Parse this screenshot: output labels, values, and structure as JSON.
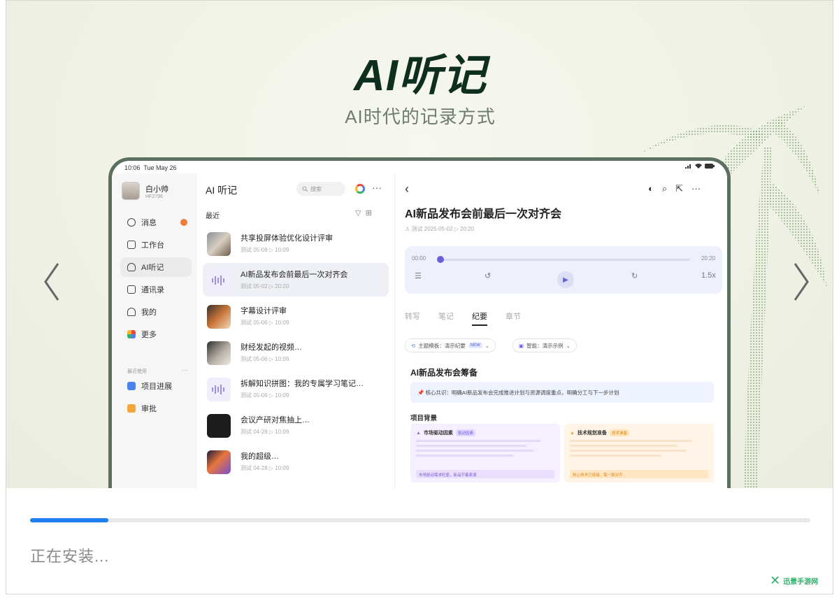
{
  "hero": {
    "title": "AI听记",
    "subtitle": "AI时代的记录方式"
  },
  "tablet": {
    "status": {
      "time": "10:06",
      "date": "Tue May 26"
    },
    "sidebar": {
      "user": {
        "name": "白小帅",
        "sub": "HF2796"
      },
      "items": [
        {
          "label": "消息",
          "icon": "message-icon",
          "badge": true
        },
        {
          "label": "工作台",
          "icon": "grid-icon"
        },
        {
          "label": "AI听记",
          "icon": "record-icon",
          "active": true
        },
        {
          "label": "通讯录",
          "icon": "contacts-icon"
        },
        {
          "label": "我的",
          "icon": "person-icon"
        },
        {
          "label": "更多",
          "icon": "apps-icon"
        }
      ],
      "recent_label": "最近使用",
      "recent_items": [
        {
          "label": "项目进展",
          "icon": "doc-icon",
          "color": "#4b82f0"
        },
        {
          "label": "审批",
          "icon": "approve-icon",
          "color": "#f3a43a"
        }
      ]
    },
    "list": {
      "title": "AI 听记",
      "search_placeholder": "搜索",
      "section": "最近",
      "items": [
        {
          "title": "共享投屏体验优化设计评审",
          "meta": "测试 05-08  ▷ 10:09",
          "thumb": "photo"
        },
        {
          "title": "AI新品发布会前最后一次对齐会",
          "meta": "测试 05-02  ▷ 20:20",
          "thumb": "wave",
          "active": true
        },
        {
          "title": "字幕设计评审",
          "meta": "测试 05-06  ▷ 10:09",
          "thumb": "photo2"
        },
        {
          "title": "财经发起的视频…",
          "meta": "测试 05-06  ▷ 10:09",
          "thumb": "photo3"
        },
        {
          "title": "拆解知识拼图：我的专属学习笔记…",
          "meta": "测试 05-06  ▷ 10:09",
          "thumb": "wave"
        },
        {
          "title": "会议产研对焦抽上…",
          "meta": "测试 04-28  ▷ 10:09",
          "thumb": "dark"
        },
        {
          "title": "我的超级…",
          "meta": "测试 04-28  ▷ 10:09",
          "thumb": "colorful"
        }
      ]
    },
    "detail": {
      "title": "AI新品发布会前最后一次对齐会",
      "meta": "♙ 测试 2025-05-02  ▷ 20:20",
      "player": {
        "start": "00:00",
        "end": "20:20",
        "speed": "1.5x",
        "progress": 0.0
      },
      "tabs": [
        "转写",
        "笔记",
        "纪要",
        "章节"
      ],
      "active_tab": "纪要",
      "chips": [
        {
          "label": "主题模板：演示纪要",
          "tag": "NEW"
        },
        {
          "label": "智能：演示示例"
        }
      ],
      "section_title": "AI新品发布会筹备",
      "notice": "核心共识：明确AI新品发布会完成推进计划与资源调度重点，明确分工与下一步计划",
      "subsection": "项目背景",
      "cards": [
        {
          "title": "市场驱动因素",
          "tag": "驱动因素",
          "foot": "市场驱动需求旺盛，新品节奏紧凑"
        },
        {
          "title": "技术规划准备",
          "tag": "技术准备",
          "foot": "核心技术已就绪，需一致对齐"
        }
      ]
    }
  },
  "install": {
    "status_text": "正在安装...",
    "progress": 0.1
  },
  "watermark": {
    "text": "迅景手游网"
  },
  "colors": {
    "accent": "#1f7ff0",
    "brand_dark": "#0e2e1f",
    "player_accent": "#6a5fd9"
  }
}
